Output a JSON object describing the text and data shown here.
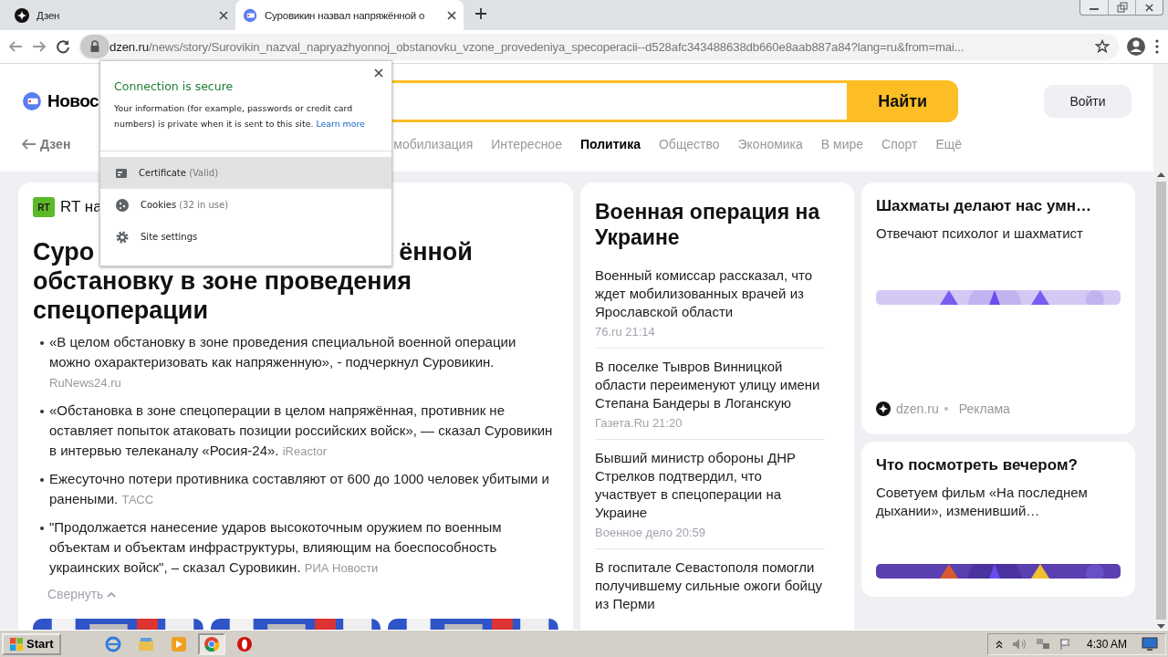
{
  "browser": {
    "tabs": [
      {
        "title": "Дзен",
        "selected": false
      },
      {
        "title": "Суровикин назвал напряжённой о",
        "selected": true
      }
    ],
    "address": {
      "host": "dzen.ru",
      "path": "/news/story/Surovikin_nazval_napryazhyonnoj_obstanovku_vzone_provedeniya_specoperacii--d528afc343488638db660e8aab887a84?lang=ru&from=mai..."
    }
  },
  "header": {
    "logo": "Новос",
    "search_button": "Найти",
    "login_button": "Войти"
  },
  "nav": {
    "back": "Дзен",
    "items": [
      {
        "label": "мобилизация",
        "selected": false
      },
      {
        "label": "Интересное",
        "selected": false
      },
      {
        "label": "Политика",
        "selected": true
      },
      {
        "label": "Общество",
        "selected": false
      },
      {
        "label": "Экономика",
        "selected": false
      },
      {
        "label": "В мире",
        "selected": false
      },
      {
        "label": "Спорт",
        "selected": false
      },
      {
        "label": "Ещё",
        "selected": false
      }
    ]
  },
  "story": {
    "source_badge": "RT",
    "source": "RT на",
    "headline": {
      "line1_start": "Суро",
      "line1_end": "ённой",
      "lines": [
        "обстановку в зоне проведения",
        "спецоперации"
      ]
    },
    "bullets": [
      {
        "text": "«В целом обстановку в зоне проведения специальной военной операции можно охарактеризовать как напряженную», - подчеркнул Суровикин.",
        "source": "RuNews24.ru"
      },
      {
        "text": "«Обстановка в зоне спецоперации в целом напряжённая, противник не оставляет попыток атаковать позиции российских войск», — сказал Суровикин в интервью телеканалу «Росия-24».",
        "source": "iReactor"
      },
      {
        "text": "Ежесуточно потери противника составляют от 600 до 1000 человек убитыми и ранеными.",
        "source": "ТАСС"
      },
      {
        "text": "\"Продолжается нанесение ударов высокоточным оружием по военным объектам и объектам инфраструктуры, влияющим на боеспособность украинских войск\", – сказал Суровикин.",
        "source": "РИА Новости"
      }
    ],
    "collapse": "Свернуть"
  },
  "topic": {
    "title": "Военная операция на Украине",
    "items": [
      {
        "title": "Военный комиссар рассказал, что ждет мобилизованных врачей из Ярославской области",
        "meta": "76.ru 21:14"
      },
      {
        "title": "В поселке Тывров Винницкой области переименуют улицу имени Степана Бандеры в Логанскую",
        "meta": "Газета.Ru 21:20"
      },
      {
        "title": "Бывший министр обороны ДНР Стрелков подтвердил, что участвует в спецоперации на Украине",
        "meta": "Военное дело 20:59"
      },
      {
        "title": "В госпитале Севастополя помогли получившему сильные ожоги бойцу из Перми"
      }
    ]
  },
  "ads": [
    {
      "title": "Шахматы делают нас умн…",
      "text": "Отвечают психолог и шахматист",
      "domain": "dzen.ru",
      "label": "Реклама"
    },
    {
      "title": "Что посмотреть вечером?",
      "text": "Советуем фильм «На последнем дыхании», изменивший…"
    }
  ],
  "popup": {
    "title": "Connection is secure",
    "text": "Your information (for example, passwords or credit card numbers) is private when it is sent to this site.",
    "link": "Learn more",
    "items": [
      {
        "kind": "certificate",
        "label": "Certificate",
        "detail": "(Valid)",
        "selected": true
      },
      {
        "kind": "cookies",
        "label": "Cookies",
        "detail": "(32 in use)",
        "selected": false
      },
      {
        "kind": "settings",
        "label": "Site settings",
        "selected": false
      }
    ]
  },
  "taskbar": {
    "start": "Start",
    "apps": [
      {
        "kind": "ie",
        "selected": false
      },
      {
        "kind": "folder",
        "selected": false
      },
      {
        "kind": "media",
        "selected": false
      },
      {
        "kind": "chrome",
        "selected": true
      },
      {
        "kind": "opera",
        "selected": false
      }
    ],
    "clock": "4:30 AM"
  }
}
